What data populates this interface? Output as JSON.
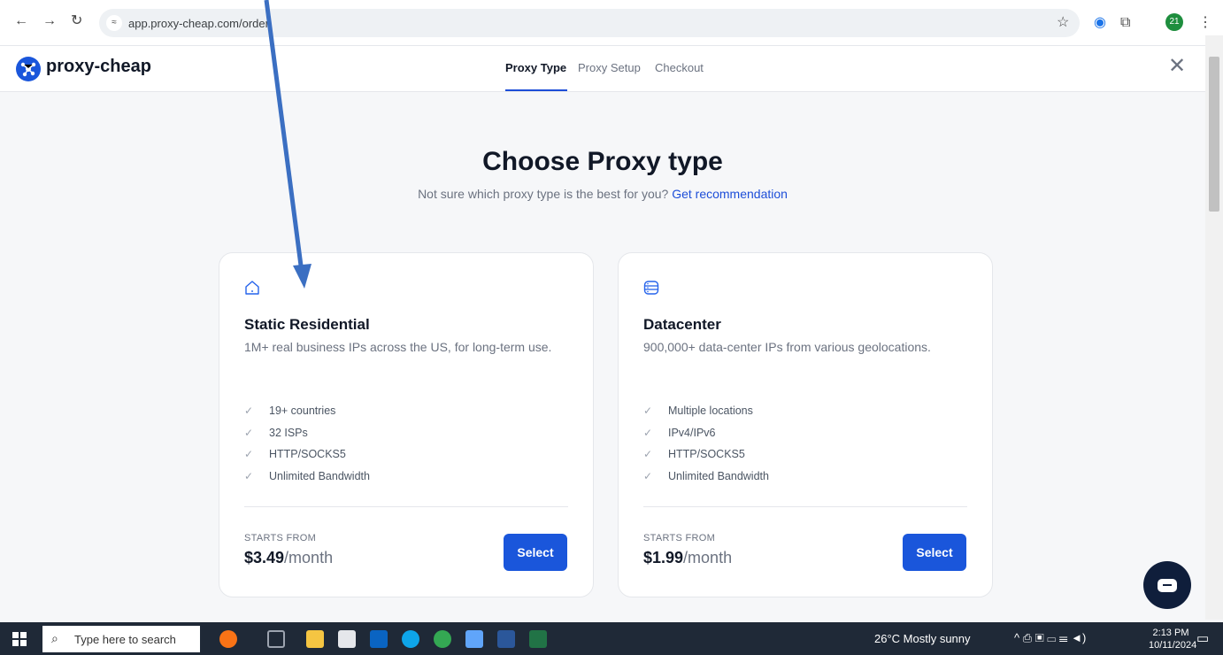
{
  "browser": {
    "url": "app.proxy-cheap.com/order",
    "profile_badge": "21"
  },
  "app": {
    "logo_text": "proxy-cheap",
    "steps": [
      "Proxy Type",
      "Proxy Setup",
      "Checkout"
    ],
    "active_step": "Proxy Type"
  },
  "page": {
    "title": "Choose Proxy type",
    "subtitle": "Not sure which proxy type is the best for you?",
    "recommendation_link": "Get recommendation"
  },
  "cards": [
    {
      "icon": "home-icon",
      "title": "Static Residential",
      "description": "1M+ real business IPs across the US, for long-term use.",
      "features": [
        "19+ countries",
        "32 ISPs",
        "HTTP/SOCKS5",
        "Unlimited Bandwidth"
      ],
      "starts_from_label": "STARTS FROM",
      "price": "$3.49",
      "price_unit": "/month",
      "button_label": "Select"
    },
    {
      "icon": "server-icon",
      "title": "Datacenter",
      "description": "900,000+ data-center IPs from various geolocations.",
      "features": [
        "Multiple locations",
        "IPv4/IPv6",
        "HTTP/SOCKS5",
        "Unlimited Bandwidth"
      ],
      "starts_from_label": "STARTS FROM",
      "price": "$1.99",
      "price_unit": "/month",
      "button_label": "Select"
    }
  ],
  "taskbar": {
    "search_placeholder": "Type here to search",
    "weather": "26°C  Mostly sunny",
    "time": "2:13 PM",
    "date": "10/11/2024"
  },
  "colors": {
    "accent": "#1a56db",
    "annotation_arrow": "#3b6fc2"
  }
}
